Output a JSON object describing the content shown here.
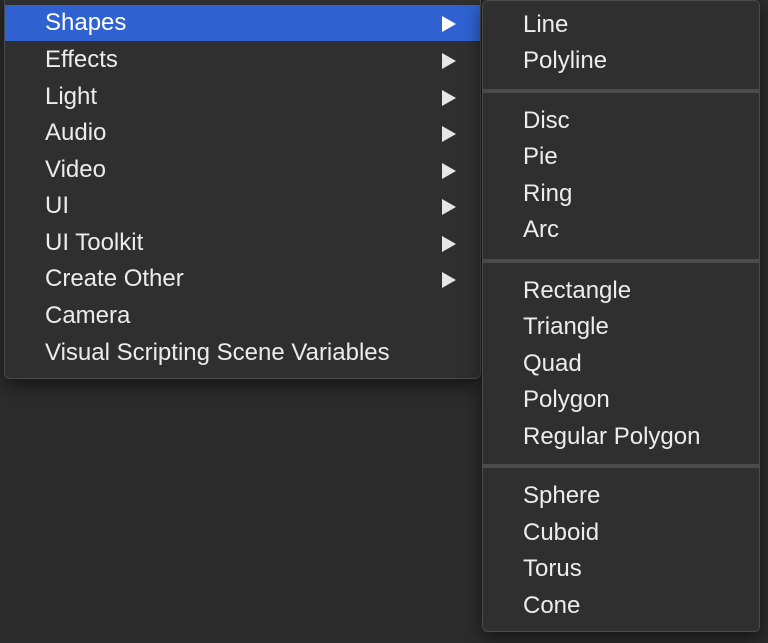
{
  "main_menu": {
    "items": [
      {
        "label": "Shapes",
        "has_submenu": true,
        "selected": true
      },
      {
        "label": "Effects",
        "has_submenu": true
      },
      {
        "label": "Light",
        "has_submenu": true
      },
      {
        "label": "Audio",
        "has_submenu": true
      },
      {
        "label": "Video",
        "has_submenu": true
      },
      {
        "label": "UI",
        "has_submenu": true
      },
      {
        "label": "UI Toolkit",
        "has_submenu": true
      },
      {
        "label": "Create Other",
        "has_submenu": true
      },
      {
        "label": "Camera",
        "has_submenu": false
      },
      {
        "label": "Visual Scripting Scene Variables",
        "has_submenu": false
      }
    ]
  },
  "submenu": {
    "groups": [
      {
        "items": [
          "Line",
          "Polyline"
        ]
      },
      {
        "items": [
          "Disc",
          "Pie",
          "Ring",
          "Arc"
        ]
      },
      {
        "items": [
          "Rectangle",
          "Triangle",
          "Quad",
          "Polygon",
          "Regular Polygon"
        ]
      },
      {
        "items": [
          "Sphere",
          "Cuboid",
          "Torus",
          "Cone"
        ]
      }
    ]
  },
  "colors": {
    "background": "#2c2c2c",
    "menu_bg": "#2f2f2f",
    "selection": "#2f62d0",
    "text": "#ececec"
  },
  "icons": {
    "submenu_arrow": "triangle-right-icon"
  }
}
